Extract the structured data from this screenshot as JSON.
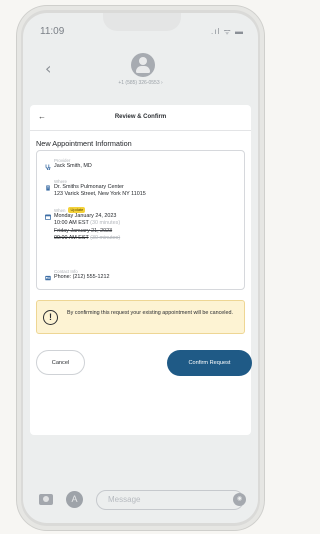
{
  "status_bar": {
    "time": "11:09",
    "icons": ".ıl ᯤ ▬"
  },
  "messages_header": {
    "back_glyph": "‹",
    "contact_number": "+1 (585) 326-0553 ›"
  },
  "sheet": {
    "back_glyph": "←",
    "title": "Review & Confirm",
    "section_title": "New Appointment Information",
    "provider": {
      "label": "Provider",
      "value": "Jack Smith, MD"
    },
    "where": {
      "label": "Where",
      "line1": "Dr. Smiths Pulmonary Center",
      "line2": "123 Varick Street, New York NY 11015"
    },
    "when": {
      "label": "When",
      "badge": "Update",
      "new_date": "Monday January 24, 2023",
      "new_time": "10:00 AM EST",
      "new_duration": "(30 minutes)",
      "old_date": "Friday January 21, 2023",
      "old_time": "09:00 AM EST",
      "old_duration": "(30 minutes)"
    },
    "contact": {
      "label": "Contact Info",
      "value": "Phone: (212) 555-1212"
    },
    "alert": {
      "icon_glyph": "!",
      "text": "By confirming this request your existing appointment will be canceled."
    },
    "cancel_label": "Cancel",
    "confirm_label": "Confirm Request"
  },
  "compose": {
    "placeholder": "Message",
    "appstore_glyph": "A",
    "audio_glyph": "◉"
  },
  "colors": {
    "primary_button": "#1f5a86",
    "alert_bg": "#fdf3d3",
    "badge": "#f4d23a",
    "icon_blue": "#3d6ea5"
  }
}
